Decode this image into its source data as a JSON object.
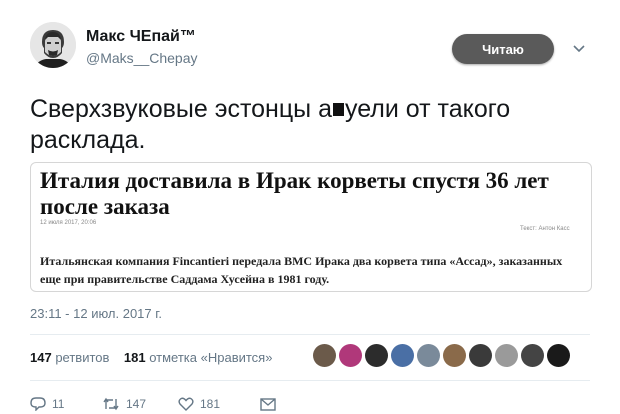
{
  "user": {
    "display_name": "Макс ЧЕпай™",
    "handle": "@Maks__Chepay"
  },
  "follow_button": {
    "label": "Читаю"
  },
  "tweet": {
    "text_before": "Сверхзвуковые эстонцы а",
    "text_after": "уели от такого расклада."
  },
  "embedded_article": {
    "title": "Италия доставила в Ирак корветы спустя 36 лет после заказа",
    "date": "12 июля 2017, 20:06",
    "author": "Текст: Антон Касс",
    "body": "Итальянская компания Fincantieri передала ВМС Ирака два корвета типа «Ассад», заказанных еще при правительстве Саддама Хусейна в 1981 году."
  },
  "timestamp": "23:11 - 12 июл. 2017 г.",
  "stats": {
    "retweets_count": "147",
    "retweets_label": "ретвитов",
    "likes_count": "181",
    "likes_label": "отметка «Нравится»"
  },
  "likers": [
    {
      "color": "#6b5a4a"
    },
    {
      "color": "#b0387a"
    },
    {
      "color": "#2c2c2c"
    },
    {
      "color": "#4a6fa5"
    },
    {
      "color": "#7a8a9a"
    },
    {
      "color": "#8a6a4a"
    },
    {
      "color": "#3a3a3a"
    },
    {
      "color": "#9a9a9a"
    },
    {
      "color": "#444444"
    },
    {
      "color": "#1a1a1a"
    }
  ],
  "actions": {
    "replies": "11",
    "retweets": "147",
    "likes": "181"
  },
  "icons": [
    "chevron-down-icon",
    "reply-icon",
    "retweet-icon",
    "heart-icon",
    "message-icon"
  ],
  "colors": {
    "follow_bg": "#5a5a5a",
    "muted": "#657786",
    "text": "#14171a"
  }
}
